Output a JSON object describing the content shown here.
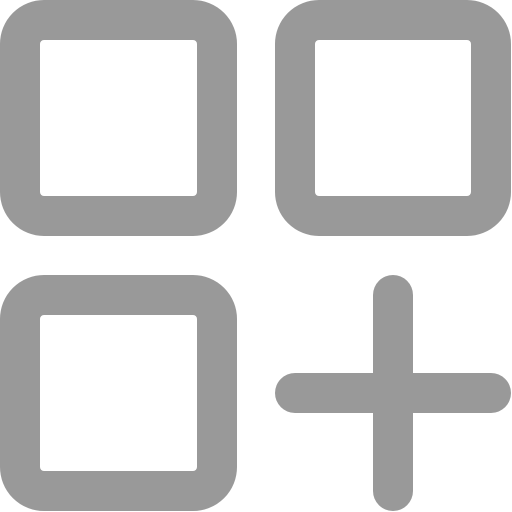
{
  "icon": {
    "name": "add-widget-icon",
    "color": "#999999",
    "background": "#ffffff",
    "parts": [
      "square-top-left",
      "square-top-right",
      "square-bottom-left",
      "plus"
    ]
  }
}
